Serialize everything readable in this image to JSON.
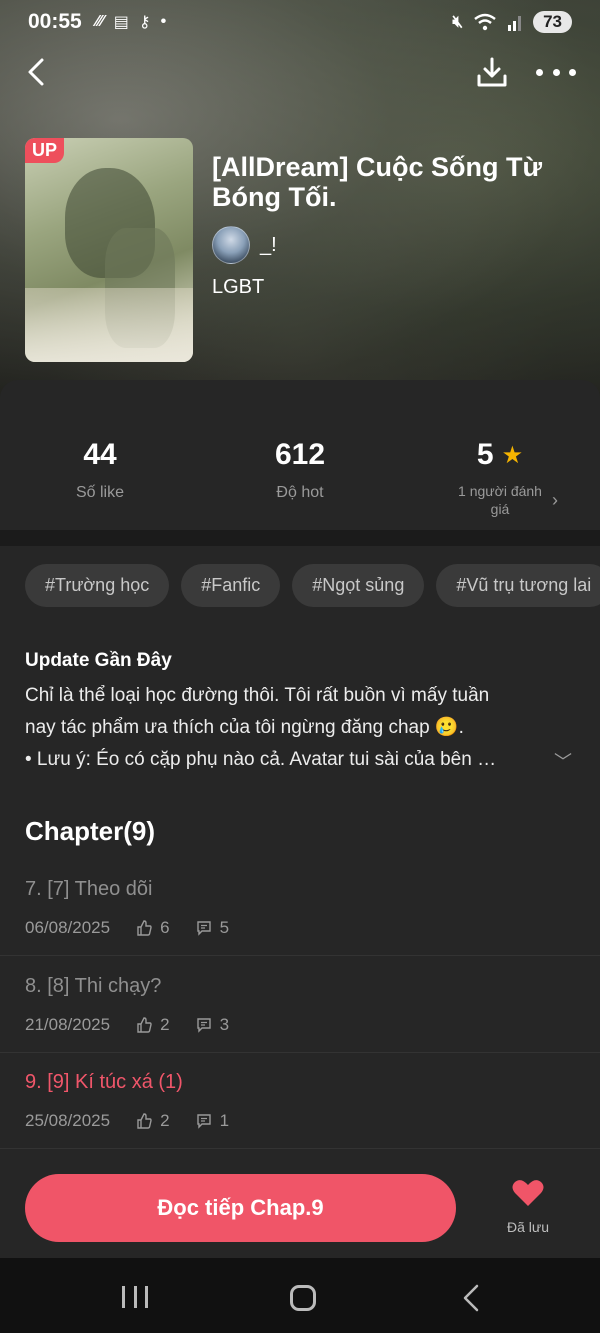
{
  "status_bar": {
    "time": "00:55",
    "left_icons": [
      "missed-call-icon",
      "calendar-icon",
      "key-icon",
      "dot-icon"
    ],
    "right_icons": [
      "mute-icon",
      "wifi-icon",
      "signal-icon"
    ],
    "battery": "73"
  },
  "story": {
    "badge": "UP",
    "title": "[AllDream] Cuộc Sống Từ Bóng Tối.",
    "author": "_!",
    "genre": "LGBT"
  },
  "stats": {
    "likes_value": "44",
    "likes_label": "Số like",
    "hot_value": "612",
    "hot_label": "Độ hot",
    "rating_value": "5",
    "rating_label": "1 người đánh giá"
  },
  "tags": [
    "#Trường học",
    "#Fanfic",
    "#Ngọt sủng",
    "#Vũ trụ tương lai"
  ],
  "update": {
    "title": "Update Gần Đây",
    "body_line1": "Chỉ là thể loại học đường thôi. Tôi rất buồn vì mấy tuần",
    "body_line2": "nay tác phẩm ưa thích của tôi ngừng đăng chap 🥲.",
    "body_line3": " • Lưu ý: Éo có cặp phụ nào cả. Avatar tui sài của bên …"
  },
  "chapters_heading": "Chapter(9)",
  "chapters": [
    {
      "title": "7. [7] Theo dõi",
      "date": "06/08/2025",
      "likes": "6",
      "comments": "5"
    },
    {
      "title": "8. [8] Thi chạy?",
      "date": "21/08/2025",
      "likes": "2",
      "comments": "3"
    },
    {
      "title": "9. [9] Kí túc xá (1)",
      "date": "25/08/2025",
      "likes": "2",
      "comments": "1"
    }
  ],
  "bottom": {
    "read_button": "Đọc tiếp Chap.9",
    "saved_label": "Đã lưu"
  },
  "colors": {
    "accent": "#f05568",
    "star": "#f5b400",
    "background": "#262626"
  }
}
